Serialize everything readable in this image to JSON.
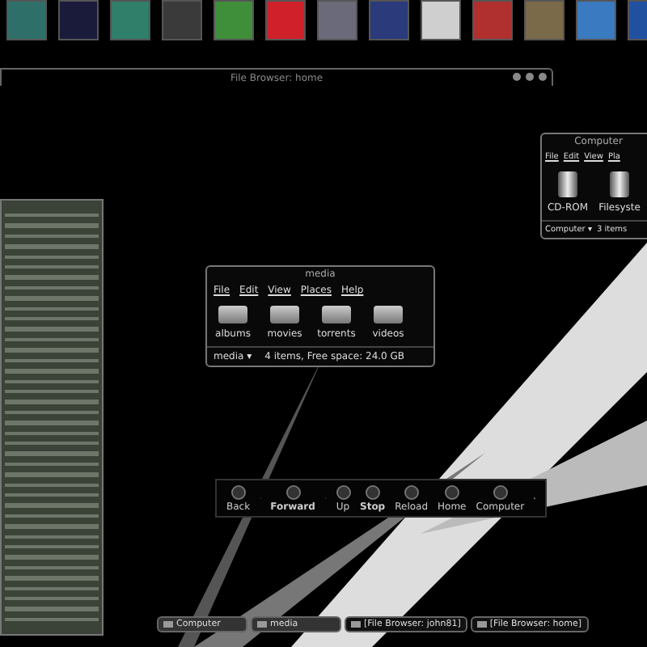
{
  "dock": {
    "icons": [
      {
        "color": "#2f6f6a"
      },
      {
        "color": "#1a1a3a"
      },
      {
        "color": "#2f7f6a"
      },
      {
        "color": "#3a3a3a"
      },
      {
        "color": "#3f8f3a"
      },
      {
        "color": "#d0202a"
      },
      {
        "color": "#6a6a7a"
      },
      {
        "color": "#2a3a7a"
      },
      {
        "color": "#cfcfcf"
      },
      {
        "color": "#b03030"
      },
      {
        "color": "#7a6a4a"
      },
      {
        "color": "#3a7ac0"
      },
      {
        "color": "#2050a0"
      }
    ]
  },
  "home_window": {
    "title": "File Browser: home"
  },
  "media_window": {
    "title": "media",
    "menu": [
      "File",
      "Edit",
      "View",
      "Places",
      "Help"
    ],
    "items": [
      "albums",
      "movies",
      "torrents",
      "videos"
    ],
    "location": "media ▾",
    "status": "4 items, Free space: 24.0 GB"
  },
  "computer_window": {
    "title": "Computer",
    "menu": [
      "File",
      "Edit",
      "View",
      "Pla"
    ],
    "items": [
      "CD-ROM",
      "Filesyste"
    ],
    "location": "Computer ▾",
    "status": "3 items"
  },
  "toolbar": {
    "buttons": [
      {
        "label": "Back",
        "kind": "arrow"
      },
      {
        "label": "Forward",
        "kind": "arrow"
      },
      {
        "label": "Up",
        "kind": "plain"
      },
      {
        "label": "Stop",
        "kind": "plain"
      },
      {
        "label": "Reload",
        "kind": "plain"
      },
      {
        "label": "Home",
        "kind": "plain"
      },
      {
        "label": "Computer",
        "kind": "plain"
      }
    ]
  },
  "taskbar": {
    "tasks": [
      {
        "label": "Computer",
        "selected": true
      },
      {
        "label": "media",
        "selected": true
      },
      {
        "label": "[File Browser: john81]",
        "selected": false
      },
      {
        "label": "[File Browser: home]",
        "selected": false
      }
    ]
  }
}
